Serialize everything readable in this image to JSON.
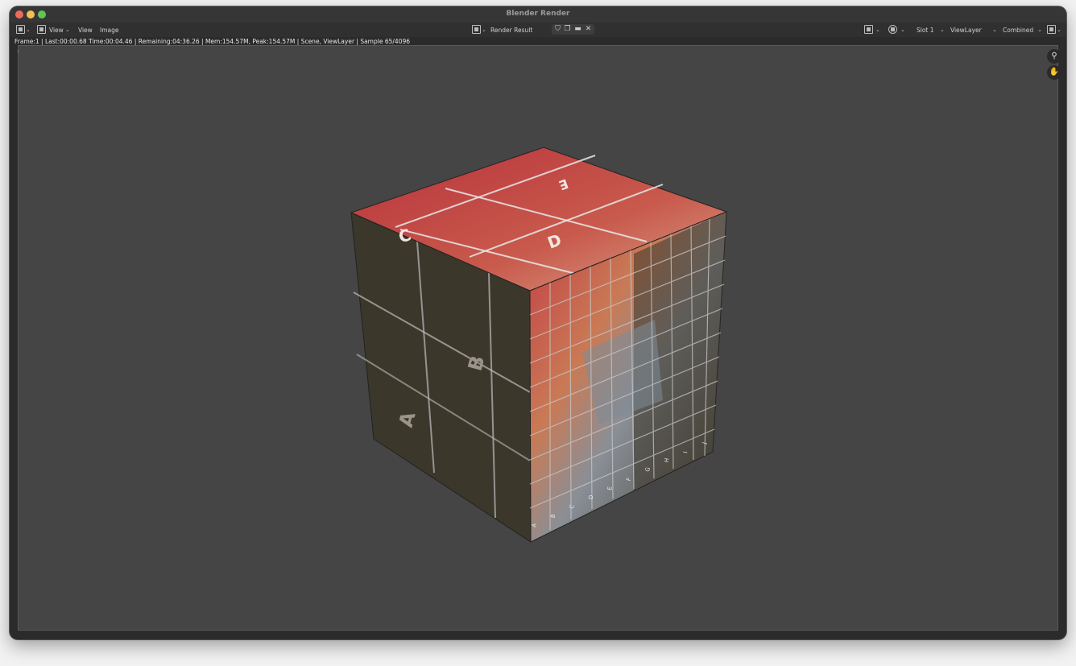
{
  "window": {
    "title": "Blender Render"
  },
  "header": {
    "menu": [
      "View",
      "View",
      "Image"
    ],
    "image_name": "Render Result",
    "slot": "Slot 1",
    "view_layer": "ViewLayer",
    "pass": "Combined"
  },
  "status": {
    "text": "Frame:1 | Last:00:00.68 Time:00:04.46 | Remaining:04:36.26 | Mem:154.57M, Peak:154.57M | Scene, ViewLayer | Sample 65/4096"
  },
  "render": {
    "left_face_letters": [
      "A",
      "B",
      "C"
    ],
    "top_face_letters": [
      "C",
      "D",
      "E"
    ],
    "right_column_letters": [
      "A",
      "B",
      "C",
      "D",
      "E",
      "F",
      "G",
      "H",
      "I",
      "J"
    ],
    "colors": {
      "background": "#454545",
      "dark_face": "#3a3528",
      "red": "#b8323c",
      "orange": "#c9744f",
      "grid_line": "#c8c8c8"
    }
  },
  "icons": {
    "editor_type": "image-editor-icon",
    "zoom": "zoom-icon",
    "pan": "hand-icon"
  }
}
